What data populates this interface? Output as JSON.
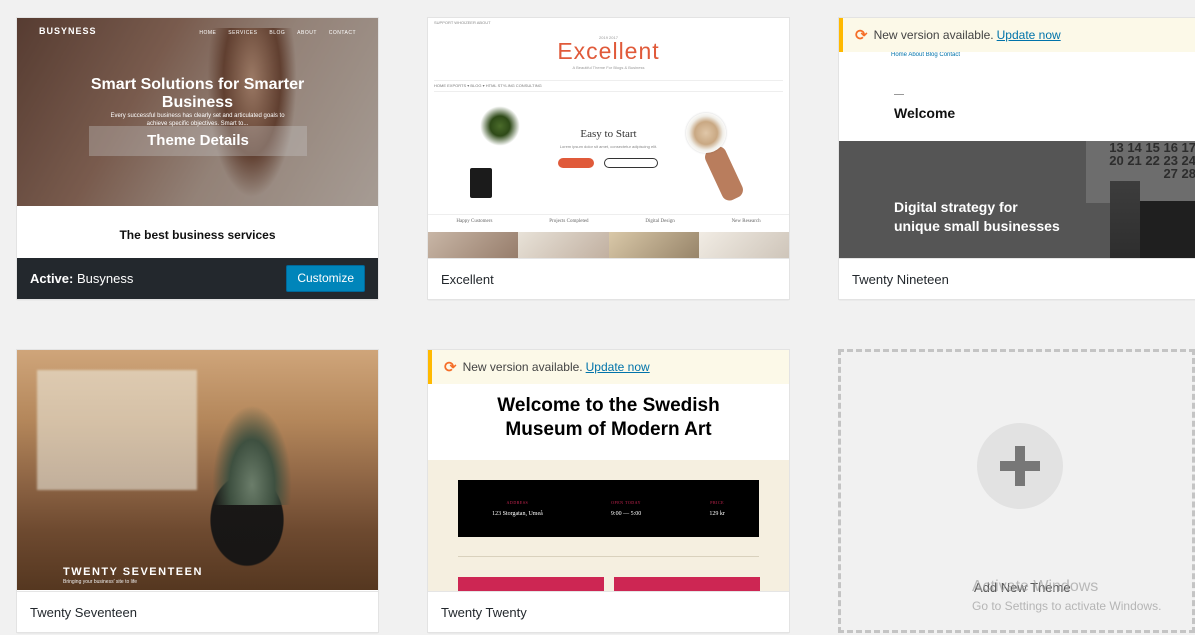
{
  "themes": {
    "busyness": {
      "active_label": "Active:",
      "name": "Busyness",
      "customize_label": "Customize",
      "screenshot": {
        "logo": "BUSYNESS",
        "nav": [
          "HOME",
          "SERVICES",
          "BLOG",
          "ABOUT",
          "CONTACT"
        ],
        "headline": "Smart Solutions for Smarter Business",
        "subtext": "Every successful business has clearly set and articulated goals to achieve specific objectives. Smart to...",
        "details_overlay": "Theme Details",
        "tagline": "The best business services"
      }
    },
    "excellent": {
      "name": "Excellent",
      "screenshot": {
        "top_links": "SUPPORT  WHOIZEER  ABOUT",
        "date": "2019   2017",
        "logo": "Excellent",
        "tagline": "A Beautiful Theme For Blogs & Business",
        "nav": "HOME   EXPORTS ▾   BLOG ▾   HTML STYLING   CONSULTING",
        "heading": "Easy to Start",
        "subheading": "Lorem ipsum dolor sit amet, consectetur adipiscing elit.",
        "stats": [
          "Happy Customers",
          "Projects Completed",
          "Digital Design",
          "New Research"
        ]
      }
    },
    "twenty_nineteen": {
      "name": "Twenty Nineteen",
      "notice_text": "New version available.",
      "notice_link": "Update now",
      "screenshot": {
        "nav": "Home  About  Blog  Contact",
        "welcome": "Welcome",
        "calendar": "13 14 15 16 17\n20 21 22 23 24\n27 28",
        "hero_text_1": "Digital strategy for",
        "hero_text_2": "unique small businesses"
      }
    },
    "twenty_seventeen": {
      "name": "Twenty Seventeen",
      "screenshot": {
        "title": "TWENTY SEVENTEEN",
        "subtitle": "Bringing your business' site to life"
      }
    },
    "twenty_twenty": {
      "name": "Twenty Twenty",
      "notice_text": "New version available.",
      "notice_link": "Update now",
      "screenshot": {
        "headline_1": "Welcome to the Swedish",
        "headline_2": "Museum of Modern Art",
        "info": [
          {
            "label": "ADDRESS",
            "value": "123 Storgatan, Umeå"
          },
          {
            "label": "OPEN TODAY",
            "value": "9:00 — 5:00"
          },
          {
            "label": "PRICE",
            "value": "129 kr"
          }
        ]
      }
    }
  },
  "add_new": {
    "label": "Add New Theme",
    "icon": "plus-icon"
  },
  "watermark": {
    "line1": "Activate Windows",
    "line2": "Go to Settings to activate Windows."
  },
  "colors": {
    "update_icon": "#f56e28",
    "notice_border": "#ffb900",
    "link": "#0073aa",
    "customize_button": "#0085ba",
    "active_bar": "#23282d"
  }
}
